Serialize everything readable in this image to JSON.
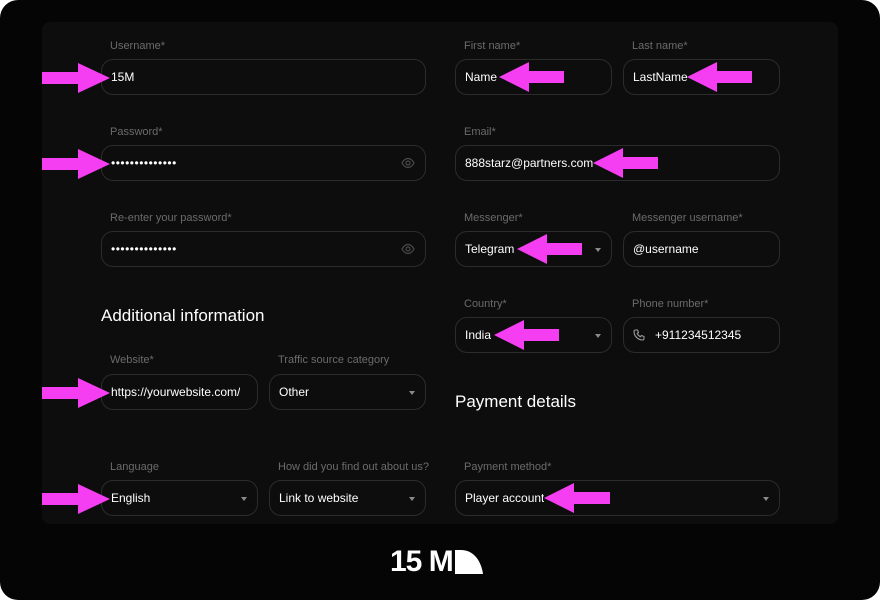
{
  "form": {
    "username": {
      "label": "Username*",
      "value": "15M"
    },
    "password": {
      "label": "Password*",
      "value": "••••••••••••••"
    },
    "reenter": {
      "label": "Re-enter your password*",
      "value": "••••••••••••••"
    },
    "first_name": {
      "label": "First name*",
      "value": "Name"
    },
    "last_name": {
      "label": "Last name*",
      "value": "LastName"
    },
    "email": {
      "label": "Email*",
      "value": "888starz@partners.com"
    },
    "messenger": {
      "label": "Messenger*",
      "value": "Telegram"
    },
    "messenger_username": {
      "label": "Messenger username*",
      "value": "@username"
    },
    "country": {
      "label": "Country*",
      "value": "India"
    },
    "phone": {
      "label": "Phone number*",
      "value": "+911234512345"
    },
    "website": {
      "label": "Website*",
      "value": "https://yourwebsite.com/"
    },
    "traffic_source": {
      "label": "Traffic source category",
      "value": "Other"
    },
    "language": {
      "label": "Language",
      "value": "English"
    },
    "found_us": {
      "label": "How did you find out about us?",
      "value": "Link to website"
    },
    "payment_method": {
      "label": "Payment method*",
      "value": "Player account"
    }
  },
  "sections": {
    "additional": "Additional information",
    "payment": "Payment details"
  },
  "brand": {
    "text": "15 M"
  },
  "colors": {
    "arrow": "#f53df2",
    "background": "#050505",
    "panel": "#0d0d0d",
    "border": "#2c2c2c"
  }
}
